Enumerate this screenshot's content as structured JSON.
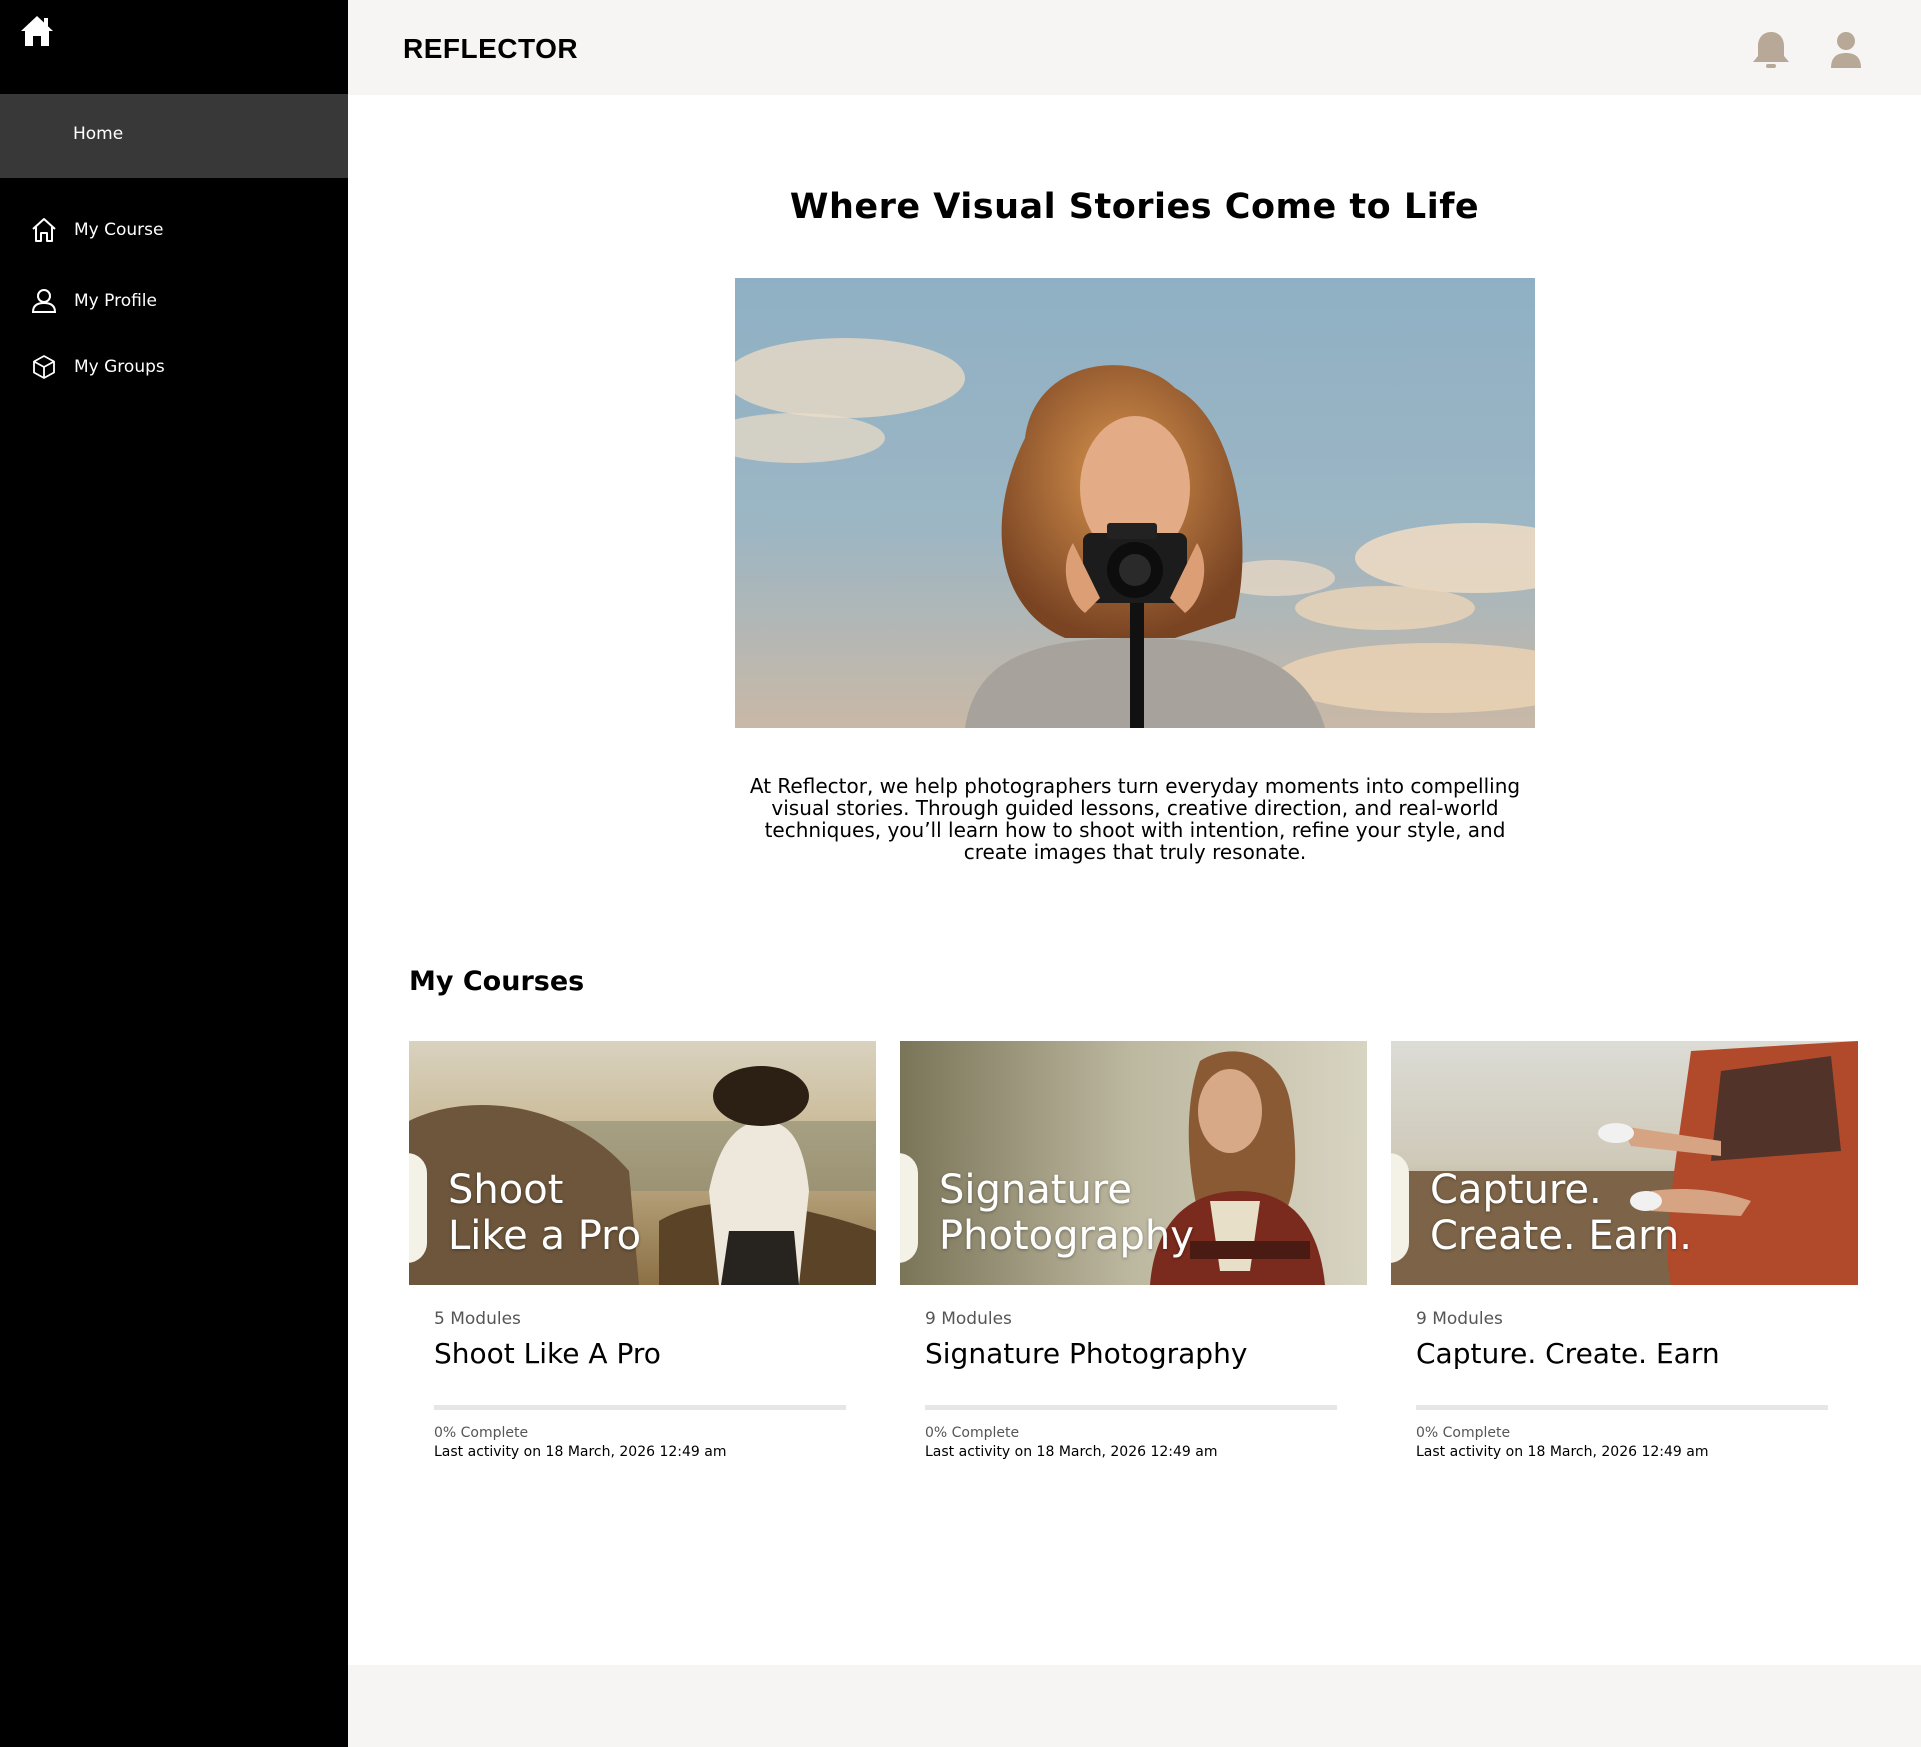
{
  "sidebar": {
    "home_label": "Home",
    "items": [
      {
        "label": "My Course",
        "icon": "home-outline-icon"
      },
      {
        "label": "My Profile",
        "icon": "person-outline-icon"
      },
      {
        "label": "My Groups",
        "icon": "cube-outline-icon"
      }
    ]
  },
  "header": {
    "brand": "REFLECTOR",
    "icons": [
      "bell-icon",
      "user-icon"
    ],
    "icon_color": "#b8a898"
  },
  "main": {
    "headline": "Where Visual Stories Come to Life",
    "intro": "At Reflector, we help photographers turn everyday moments into compelling visual stories. Through guided lessons, creative direction, and real-world techniques, you’ll learn how to shoot with intention, refine your style, and create images that truly resonate.",
    "section_title": "My Courses"
  },
  "courses": [
    {
      "overlay_title": "Shoot\nLike a Pro",
      "modules": "5 Modules",
      "title": "Shoot Like A Pro",
      "progress": 0,
      "complete": "0% Complete",
      "activity": "Last activity on 18 March, 2026 12:49 am"
    },
    {
      "overlay_title": "Signature\nPhotography",
      "modules": "9 Modules",
      "title": "Signature Photography",
      "progress": 0,
      "complete": "0% Complete",
      "activity": "Last activity on 18 March, 2026 12:49 am"
    },
    {
      "overlay_title": "Capture.\nCreate. Earn.",
      "modules": "9 Modules",
      "title": "Capture. Create. Earn",
      "progress": 0,
      "complete": "0% Complete",
      "activity": "Last activity on 18 March, 2026 12:49 am"
    }
  ]
}
